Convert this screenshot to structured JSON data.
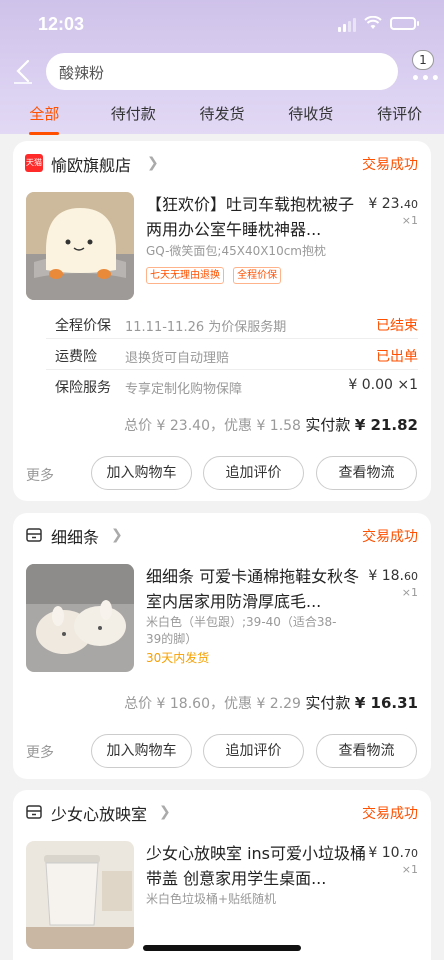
{
  "status_bar": {
    "time": "12:03"
  },
  "search": {
    "query": "酸辣粉"
  },
  "header": {
    "more_badge": "1"
  },
  "tabs": [
    {
      "label": "全部",
      "active": true
    },
    {
      "label": "待付款"
    },
    {
      "label": "待发货"
    },
    {
      "label": "待收货"
    },
    {
      "label": "待评价"
    }
  ],
  "orders": [
    {
      "shop_badge": "天猫",
      "shop_name": "愉欧旗舰店",
      "status": "交易成功",
      "title": "【狂欢价】吐司车载抱枕被子两用办公室午睡枕神器...",
      "price_main": "¥ 23.",
      "price_dec": "40",
      "qty": "×1",
      "sku": "GQ-微笑面包;45X40X10cm抱枕",
      "tags": [
        "七天无理由退换",
        "全程价保"
      ],
      "services": [
        {
          "label": "全程价保",
          "desc": "11.11-11.26 为价保服务期",
          "right": "已结束"
        },
        {
          "label": "运费险",
          "desc": "退换货可自动理赔",
          "right": "已出单"
        },
        {
          "label": "保险服务",
          "desc": "专享定制化购物保障",
          "right": "¥ 0.00 ×1"
        }
      ],
      "total_label": "总价",
      "total_value": "¥ 23.40",
      "discount_label": "，优惠",
      "discount_value": "¥ 1.58",
      "paid_label": "实付款",
      "paid_value": "¥ 21.82",
      "more": "更多",
      "buttons": [
        "加入购物车",
        "追加评价",
        "查看物流"
      ]
    },
    {
      "shop_name": "细细条",
      "status": "交易成功",
      "title": "细细条 可爱卡通棉拖鞋女秋冬室内居家用防滑厚底毛...",
      "price_main": "¥ 18.",
      "price_dec": "60",
      "qty": "×1",
      "sku": "米白色（半包跟）;39-40（适合38-39的脚）",
      "ship_note": "30天内发货",
      "total_label": "总价",
      "total_value": "¥ 18.60",
      "discount_label": "，优惠",
      "discount_value": "¥ 2.29",
      "paid_label": "实付款",
      "paid_value": "¥ 16.31",
      "more": "更多",
      "buttons": [
        "加入购物车",
        "追加评价",
        "查看物流"
      ]
    },
    {
      "shop_name": "少女心放映室",
      "status": "交易成功",
      "title": "少女心放映室 ins可爱小垃圾桶带盖 创意家用学生桌面...",
      "price_main": "¥ 10.",
      "price_dec": "70",
      "qty": "×1",
      "sku": "米白色垃圾桶+贴纸随机"
    }
  ],
  "colors": {
    "accent": "#ff5000",
    "header_bg": "#d6cbee",
    "ship_note": "#f5a000"
  },
  "icons": [
    "back-arrow-icon",
    "more-dots-icon",
    "tmall-icon",
    "shop-icon",
    "chevron-right-icon"
  ]
}
